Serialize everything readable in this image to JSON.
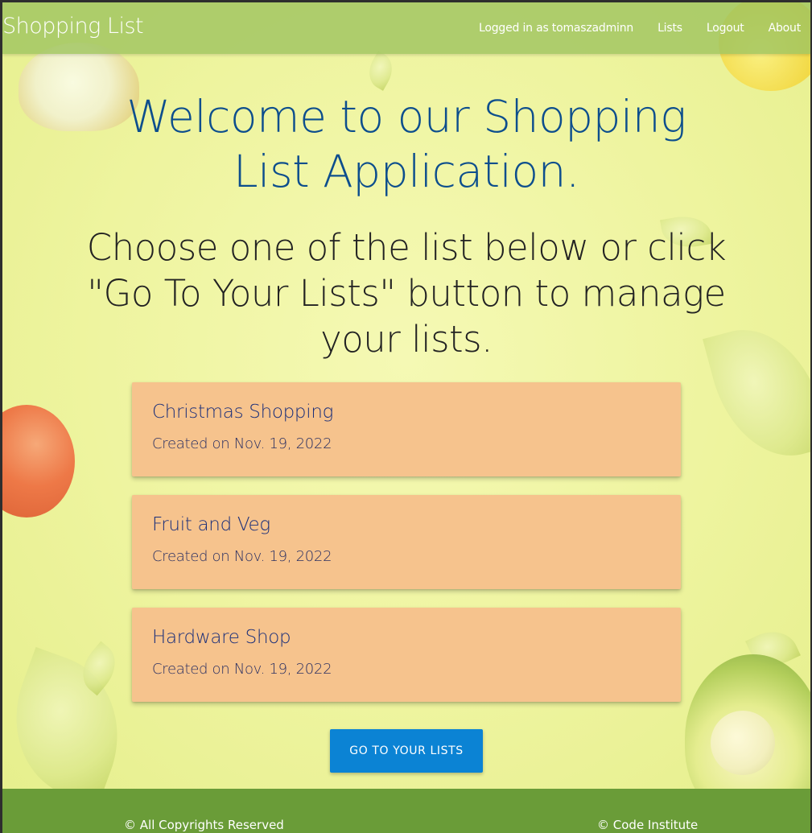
{
  "navbar": {
    "brand": "Shopping List",
    "links": {
      "logged_in": "Logged in as tomaszadminn",
      "lists": "Lists",
      "logout": "Logout",
      "about": "About"
    }
  },
  "main": {
    "welcome": "Welcome to our Shopping List Application.",
    "subtitle": "Choose one of the list below or click \"Go To Your Lists\" button to manage your lists.",
    "lists": [
      {
        "title": "Christmas Shopping",
        "created": "Created on Nov. 19, 2022"
      },
      {
        "title": "Fruit and Veg",
        "created": "Created on Nov. 19, 2022"
      },
      {
        "title": "Hardware Shop",
        "created": "Created on Nov. 19, 2022"
      }
    ],
    "cta_label": "Go To Your Lists"
  },
  "footer": {
    "left": "© All Copyrights Reserved",
    "right": "© Code Institute"
  },
  "colors": {
    "navbar": "#a0c460",
    "heading": "#0d4e8d",
    "card": "#f6c38d",
    "button": "#0b83d4",
    "footer": "#6a9c38"
  }
}
